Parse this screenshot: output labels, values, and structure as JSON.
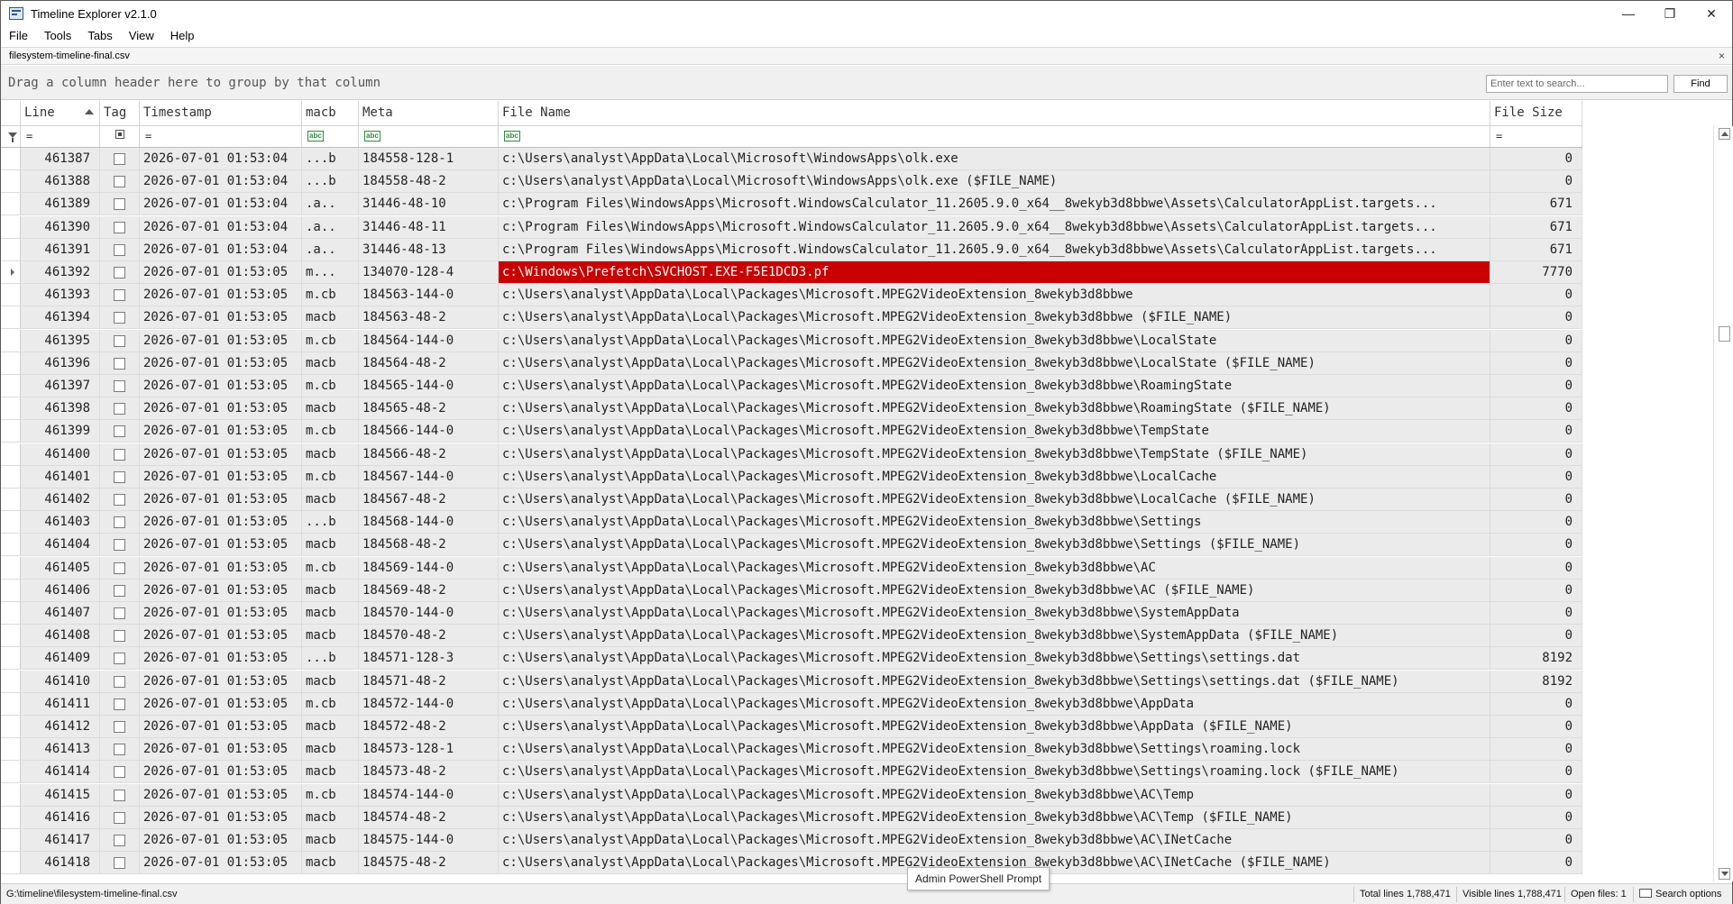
{
  "window": {
    "title": "Timeline Explorer v2.1.0",
    "minimize": "—",
    "restore": "❐",
    "close": "✕"
  },
  "menu": [
    "File",
    "Tools",
    "Tabs",
    "View",
    "Help"
  ],
  "file_tab": {
    "label": "filesystem-timeline-final.csv",
    "close": "×"
  },
  "group_panel": {
    "hint": "Drag a column header here to group by that column",
    "search_placeholder": "Enter text to search...",
    "find_label": "Find"
  },
  "columns": {
    "line": "Line",
    "tag": "Tag",
    "timestamp": "Timestamp",
    "macb": "macb",
    "meta": "Meta",
    "file_name": "File Name",
    "file_size": "File Size"
  },
  "filter_ops": {
    "equals": "=",
    "contains": "abc"
  },
  "rows": [
    {
      "line": "461387",
      "timestamp": "2026-07-01 01:53:04",
      "macb": "...b",
      "meta": "184558-128-1",
      "file_name": "c:\\Users\\analyst\\AppData\\Local\\Microsoft\\WindowsApps\\olk.exe",
      "file_size": "0"
    },
    {
      "line": "461388",
      "timestamp": "2026-07-01 01:53:04",
      "macb": "...b",
      "meta": "184558-48-2",
      "file_name": "c:\\Users\\analyst\\AppData\\Local\\Microsoft\\WindowsApps\\olk.exe ($FILE_NAME)",
      "file_size": "0"
    },
    {
      "line": "461389",
      "timestamp": "2026-07-01 01:53:04",
      "macb": ".a..",
      "meta": "31446-48-10",
      "file_name": "c:\\Program Files\\WindowsApps\\Microsoft.WindowsCalculator_11.2605.9.0_x64__8wekyb3d8bbwe\\Assets\\CalculatorAppList.targets...",
      "file_size": "671"
    },
    {
      "line": "461390",
      "timestamp": "2026-07-01 01:53:04",
      "macb": ".a..",
      "meta": "31446-48-11",
      "file_name": "c:\\Program Files\\WindowsApps\\Microsoft.WindowsCalculator_11.2605.9.0_x64__8wekyb3d8bbwe\\Assets\\CalculatorAppList.targets...",
      "file_size": "671"
    },
    {
      "line": "461391",
      "timestamp": "2026-07-01 01:53:04",
      "macb": ".a..",
      "meta": "31446-48-13",
      "file_name": "c:\\Program Files\\WindowsApps\\Microsoft.WindowsCalculator_11.2605.9.0_x64__8wekyb3d8bbwe\\Assets\\CalculatorAppList.targets...",
      "file_size": "671"
    },
    {
      "line": "461392",
      "timestamp": "2026-07-01 01:53:05",
      "macb": "m...",
      "meta": "134070-128-4",
      "file_name": "c:\\Windows\\Prefetch\\SVCHOST.EXE-F5E1DCD3.pf",
      "file_size": "7770",
      "highlight": true,
      "current": true
    },
    {
      "line": "461393",
      "timestamp": "2026-07-01 01:53:05",
      "macb": "m.cb",
      "meta": "184563-144-0",
      "file_name": "c:\\Users\\analyst\\AppData\\Local\\Packages\\Microsoft.MPEG2VideoExtension_8wekyb3d8bbwe",
      "file_size": "0"
    },
    {
      "line": "461394",
      "timestamp": "2026-07-01 01:53:05",
      "macb": "macb",
      "meta": "184563-48-2",
      "file_name": "c:\\Users\\analyst\\AppData\\Local\\Packages\\Microsoft.MPEG2VideoExtension_8wekyb3d8bbwe ($FILE_NAME)",
      "file_size": "0"
    },
    {
      "line": "461395",
      "timestamp": "2026-07-01 01:53:05",
      "macb": "m.cb",
      "meta": "184564-144-0",
      "file_name": "c:\\Users\\analyst\\AppData\\Local\\Packages\\Microsoft.MPEG2VideoExtension_8wekyb3d8bbwe\\LocalState",
      "file_size": "0"
    },
    {
      "line": "461396",
      "timestamp": "2026-07-01 01:53:05",
      "macb": "macb",
      "meta": "184564-48-2",
      "file_name": "c:\\Users\\analyst\\AppData\\Local\\Packages\\Microsoft.MPEG2VideoExtension_8wekyb3d8bbwe\\LocalState ($FILE_NAME)",
      "file_size": "0"
    },
    {
      "line": "461397",
      "timestamp": "2026-07-01 01:53:05",
      "macb": "m.cb",
      "meta": "184565-144-0",
      "file_name": "c:\\Users\\analyst\\AppData\\Local\\Packages\\Microsoft.MPEG2VideoExtension_8wekyb3d8bbwe\\RoamingState",
      "file_size": "0"
    },
    {
      "line": "461398",
      "timestamp": "2026-07-01 01:53:05",
      "macb": "macb",
      "meta": "184565-48-2",
      "file_name": "c:\\Users\\analyst\\AppData\\Local\\Packages\\Microsoft.MPEG2VideoExtension_8wekyb3d8bbwe\\RoamingState ($FILE_NAME)",
      "file_size": "0"
    },
    {
      "line": "461399",
      "timestamp": "2026-07-01 01:53:05",
      "macb": "m.cb",
      "meta": "184566-144-0",
      "file_name": "c:\\Users\\analyst\\AppData\\Local\\Packages\\Microsoft.MPEG2VideoExtension_8wekyb3d8bbwe\\TempState",
      "file_size": "0"
    },
    {
      "line": "461400",
      "timestamp": "2026-07-01 01:53:05",
      "macb": "macb",
      "meta": "184566-48-2",
      "file_name": "c:\\Users\\analyst\\AppData\\Local\\Packages\\Microsoft.MPEG2VideoExtension_8wekyb3d8bbwe\\TempState ($FILE_NAME)",
      "file_size": "0"
    },
    {
      "line": "461401",
      "timestamp": "2026-07-01 01:53:05",
      "macb": "m.cb",
      "meta": "184567-144-0",
      "file_name": "c:\\Users\\analyst\\AppData\\Local\\Packages\\Microsoft.MPEG2VideoExtension_8wekyb3d8bbwe\\LocalCache",
      "file_size": "0"
    },
    {
      "line": "461402",
      "timestamp": "2026-07-01 01:53:05",
      "macb": "macb",
      "meta": "184567-48-2",
      "file_name": "c:\\Users\\analyst\\AppData\\Local\\Packages\\Microsoft.MPEG2VideoExtension_8wekyb3d8bbwe\\LocalCache ($FILE_NAME)",
      "file_size": "0"
    },
    {
      "line": "461403",
      "timestamp": "2026-07-01 01:53:05",
      "macb": "...b",
      "meta": "184568-144-0",
      "file_name": "c:\\Users\\analyst\\AppData\\Local\\Packages\\Microsoft.MPEG2VideoExtension_8wekyb3d8bbwe\\Settings",
      "file_size": "0"
    },
    {
      "line": "461404",
      "timestamp": "2026-07-01 01:53:05",
      "macb": "macb",
      "meta": "184568-48-2",
      "file_name": "c:\\Users\\analyst\\AppData\\Local\\Packages\\Microsoft.MPEG2VideoExtension_8wekyb3d8bbwe\\Settings ($FILE_NAME)",
      "file_size": "0"
    },
    {
      "line": "461405",
      "timestamp": "2026-07-01 01:53:05",
      "macb": "m.cb",
      "meta": "184569-144-0",
      "file_name": "c:\\Users\\analyst\\AppData\\Local\\Packages\\Microsoft.MPEG2VideoExtension_8wekyb3d8bbwe\\AC",
      "file_size": "0"
    },
    {
      "line": "461406",
      "timestamp": "2026-07-01 01:53:05",
      "macb": "macb",
      "meta": "184569-48-2",
      "file_name": "c:\\Users\\analyst\\AppData\\Local\\Packages\\Microsoft.MPEG2VideoExtension_8wekyb3d8bbwe\\AC ($FILE_NAME)",
      "file_size": "0"
    },
    {
      "line": "461407",
      "timestamp": "2026-07-01 01:53:05",
      "macb": "macb",
      "meta": "184570-144-0",
      "file_name": "c:\\Users\\analyst\\AppData\\Local\\Packages\\Microsoft.MPEG2VideoExtension_8wekyb3d8bbwe\\SystemAppData",
      "file_size": "0"
    },
    {
      "line": "461408",
      "timestamp": "2026-07-01 01:53:05",
      "macb": "macb",
      "meta": "184570-48-2",
      "file_name": "c:\\Users\\analyst\\AppData\\Local\\Packages\\Microsoft.MPEG2VideoExtension_8wekyb3d8bbwe\\SystemAppData ($FILE_NAME)",
      "file_size": "0"
    },
    {
      "line": "461409",
      "timestamp": "2026-07-01 01:53:05",
      "macb": "...b",
      "meta": "184571-128-3",
      "file_name": "c:\\Users\\analyst\\AppData\\Local\\Packages\\Microsoft.MPEG2VideoExtension_8wekyb3d8bbwe\\Settings\\settings.dat",
      "file_size": "8192"
    },
    {
      "line": "461410",
      "timestamp": "2026-07-01 01:53:05",
      "macb": "macb",
      "meta": "184571-48-2",
      "file_name": "c:\\Users\\analyst\\AppData\\Local\\Packages\\Microsoft.MPEG2VideoExtension_8wekyb3d8bbwe\\Settings\\settings.dat ($FILE_NAME)",
      "file_size": "8192"
    },
    {
      "line": "461411",
      "timestamp": "2026-07-01 01:53:05",
      "macb": "m.cb",
      "meta": "184572-144-0",
      "file_name": "c:\\Users\\analyst\\AppData\\Local\\Packages\\Microsoft.MPEG2VideoExtension_8wekyb3d8bbwe\\AppData",
      "file_size": "0"
    },
    {
      "line": "461412",
      "timestamp": "2026-07-01 01:53:05",
      "macb": "macb",
      "meta": "184572-48-2",
      "file_name": "c:\\Users\\analyst\\AppData\\Local\\Packages\\Microsoft.MPEG2VideoExtension_8wekyb3d8bbwe\\AppData ($FILE_NAME)",
      "file_size": "0"
    },
    {
      "line": "461413",
      "timestamp": "2026-07-01 01:53:05",
      "macb": "macb",
      "meta": "184573-128-1",
      "file_name": "c:\\Users\\analyst\\AppData\\Local\\Packages\\Microsoft.MPEG2VideoExtension_8wekyb3d8bbwe\\Settings\\roaming.lock",
      "file_size": "0"
    },
    {
      "line": "461414",
      "timestamp": "2026-07-01 01:53:05",
      "macb": "macb",
      "meta": "184573-48-2",
      "file_name": "c:\\Users\\analyst\\AppData\\Local\\Packages\\Microsoft.MPEG2VideoExtension_8wekyb3d8bbwe\\Settings\\roaming.lock ($FILE_NAME)",
      "file_size": "0"
    },
    {
      "line": "461415",
      "timestamp": "2026-07-01 01:53:05",
      "macb": "m.cb",
      "meta": "184574-144-0",
      "file_name": "c:\\Users\\analyst\\AppData\\Local\\Packages\\Microsoft.MPEG2VideoExtension_8wekyb3d8bbwe\\AC\\Temp",
      "file_size": "0"
    },
    {
      "line": "461416",
      "timestamp": "2026-07-01 01:53:05",
      "macb": "macb",
      "meta": "184574-48-2",
      "file_name": "c:\\Users\\analyst\\AppData\\Local\\Packages\\Microsoft.MPEG2VideoExtension_8wekyb3d8bbwe\\AC\\Temp ($FILE_NAME)",
      "file_size": "0"
    },
    {
      "line": "461417",
      "timestamp": "2026-07-01 01:53:05",
      "macb": "macb",
      "meta": "184575-144-0",
      "file_name": "c:\\Users\\analyst\\AppData\\Local\\Packages\\Microsoft.MPEG2VideoExtension_8wekyb3d8bbwe\\AC\\INetCache",
      "file_size": "0"
    },
    {
      "line": "461418",
      "timestamp": "2026-07-01 01:53:05",
      "macb": "macb",
      "meta": "184575-48-2",
      "file_name": "c:\\Users\\analyst\\AppData\\Local\\Packages\\Microsoft.MPEG2VideoExtension_8wekyb3d8bbwe\\AC\\INetCache ($FILE_NAME)",
      "file_size": "0"
    }
  ],
  "status": {
    "path": "G:\\timeline\\filesystem-timeline-final.csv",
    "total_lines": "Total lines 1,788,471",
    "visible_lines": "Visible lines 1,788,471",
    "open_files": "Open files: 1",
    "search_options": "Search options"
  },
  "tooltip": "Admin PowerShell Prompt",
  "colors": {
    "highlight_row": "#c80000",
    "row_bg": "#ebebeb",
    "filter_icon": "#2e8b3a"
  }
}
